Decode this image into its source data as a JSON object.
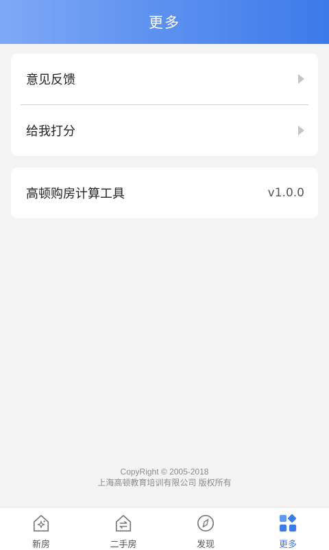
{
  "header": {
    "title": "更多"
  },
  "menu": {
    "items": [
      {
        "label": "意见反馈",
        "icon": "chevron-right-icon"
      },
      {
        "label": "给我打分",
        "icon": "chevron-right-icon"
      }
    ]
  },
  "app_info": {
    "name": "高顿购房计算工具",
    "version": "v1.0.0"
  },
  "footer": {
    "copyright": "CopyRight © 2005-2018",
    "company": "上海高顿教育培训有限公司 版权所有"
  },
  "tabs": [
    {
      "label": "新房",
      "icon": "new-house-icon",
      "active": false
    },
    {
      "label": "二手房",
      "icon": "second-hand-house-icon",
      "active": false
    },
    {
      "label": "发现",
      "icon": "compass-icon",
      "active": false
    },
    {
      "label": "更多",
      "icon": "more-grid-icon",
      "active": true
    }
  ],
  "colors": {
    "accent": "#3d7be9",
    "header_gradient_start": "#7ea9f6",
    "header_gradient_end": "#3c7ae9",
    "background": "#f4f4f4",
    "inactive_icon": "#777777"
  }
}
